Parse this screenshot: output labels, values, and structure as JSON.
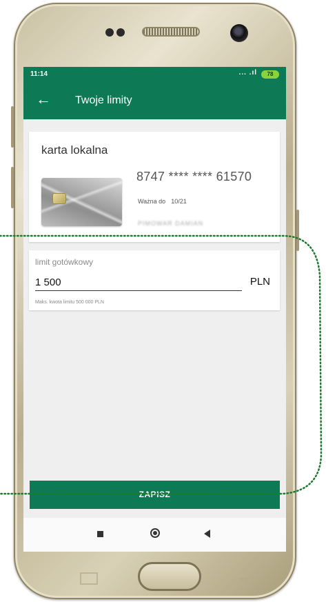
{
  "status_bar": {
    "time": "11:14",
    "signal": "... .ıl",
    "battery": "78"
  },
  "app_bar": {
    "title": "Twoje limity"
  },
  "card": {
    "name": "karta lokalna",
    "number": "8747 **** **** 61570",
    "valid_label": "Ważna do",
    "valid_value": "10/21",
    "holder": "PIMOWAR DAMIAN"
  },
  "limit": {
    "label": "limit gotówkowy",
    "value": "1 500",
    "currency": "PLN",
    "hint": "Maks. kwota limitu 500 000 PLN"
  },
  "save_button": {
    "label": "ZAPISZ"
  },
  "colors": {
    "brand_green": "#0e7a55",
    "highlight_dots": "#1c7a2e"
  },
  "icons": {
    "back": "arrow-left-icon",
    "nav_recent": "square-icon",
    "nav_home": "circle-icon",
    "nav_back": "triangle-back-icon"
  }
}
